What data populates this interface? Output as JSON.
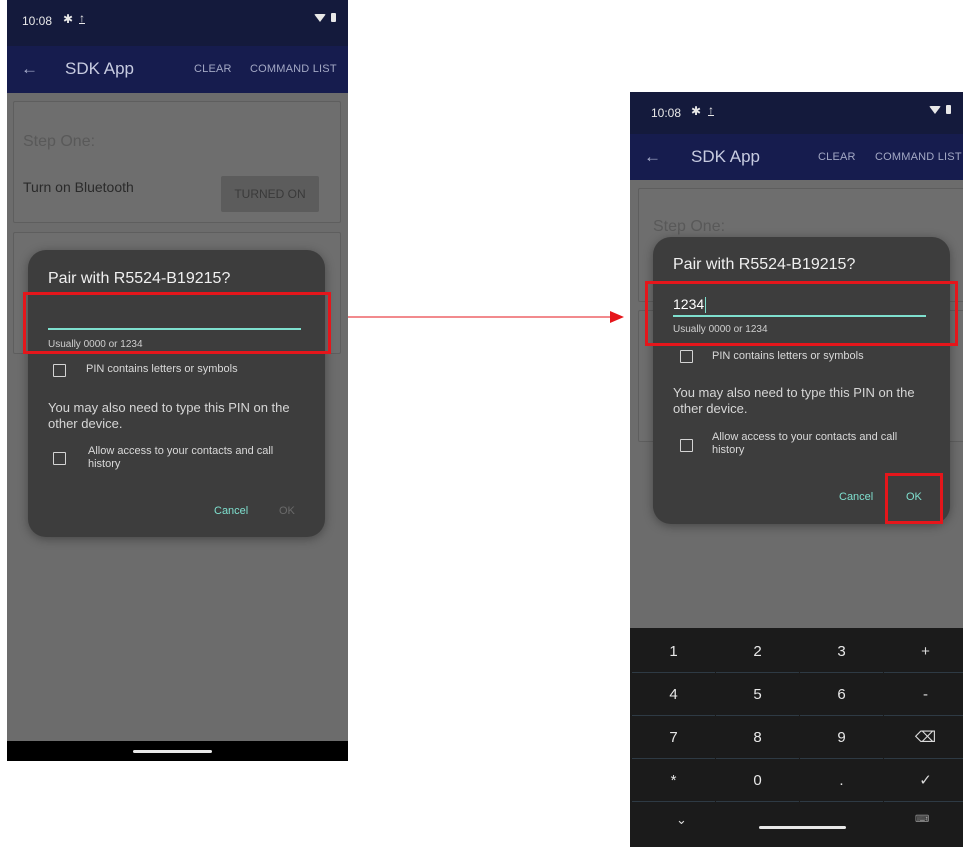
{
  "status": {
    "time": "10:08",
    "bluetooth_icon": "bluetooth-icon",
    "upload_icon": "upload-icon",
    "wifi_icon": "wifi-icon",
    "battery_icon": "battery-icon"
  },
  "appbar": {
    "back_icon": "arrow-left-icon",
    "title": "SDK App",
    "clear": "CLEAR",
    "command_list": "COMMAND LIST"
  },
  "card": {
    "step": "Step One:",
    "label": "Turn on Bluetooth",
    "button": "TURNED ON"
  },
  "dialog": {
    "title": "Pair with R5524-B19215?",
    "hint": "Usually 0000 or 1234",
    "pin_value_left": "",
    "pin_value_right": "1234",
    "checkbox_pin_letters": "PIN contains letters or symbols",
    "note": "You may also need to type this PIN on the other device.",
    "checkbox_contacts": "Allow access to your contacts and call history",
    "cancel": "Cancel",
    "ok": "OK"
  },
  "keypad": {
    "keys": [
      "1",
      "2",
      "3",
      "+",
      "4",
      "5",
      "6",
      "-",
      "7",
      "8",
      "9",
      "⌫",
      "*",
      "0",
      ".",
      "✓"
    ],
    "bottom_left_icon": "chevron-down-icon",
    "bottom_right_icon": "keyboard-icon"
  },
  "colors": {
    "highlight": "#e5161b",
    "accent": "#7fe0cf",
    "appbar": "#161c4e"
  }
}
